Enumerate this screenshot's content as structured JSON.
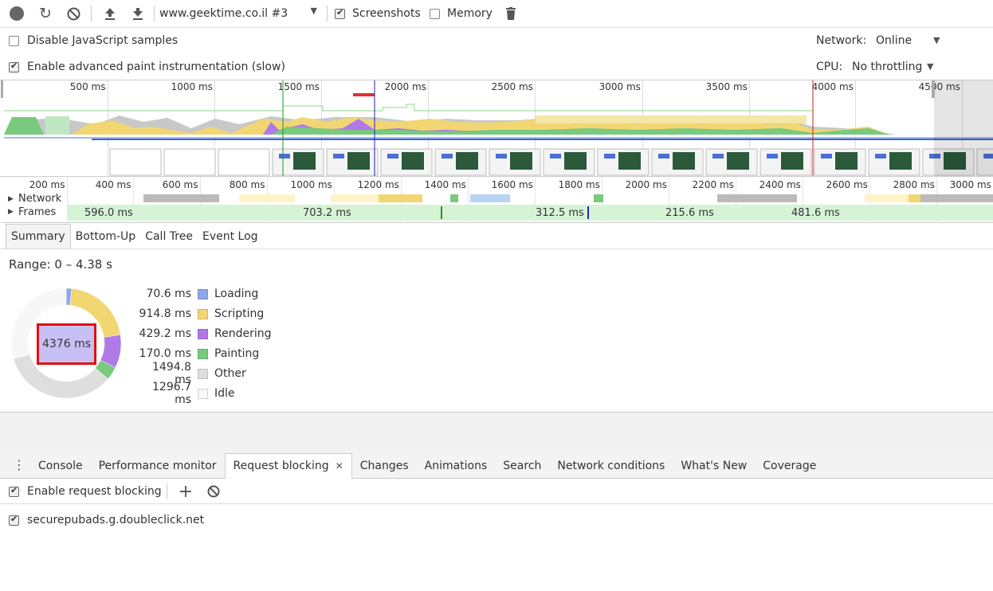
{
  "toolbar": {
    "record_icon": "record-icon",
    "reload_icon": "reload-icon",
    "clear_icon": "clear-icon",
    "upload_icon": "upload-icon",
    "download_icon": "download-icon",
    "profile_select": "www.geektime.co.il #3",
    "screenshots_label": "Screenshots",
    "screenshots_checked": true,
    "memory_label": "Memory",
    "memory_checked": false,
    "trash_icon": "trash-icon"
  },
  "settings": {
    "disable_js_label": "Disable JavaScript samples",
    "disable_js_checked": false,
    "advanced_paint_label": "Enable advanced paint instrumentation (slow)",
    "advanced_paint_checked": true,
    "network_label": "Network:",
    "network_value": "Online",
    "cpu_label": "CPU:",
    "cpu_value": "No throttling"
  },
  "overview": {
    "ticks": [
      "500 ms",
      "1000 ms",
      "1500 ms",
      "2000 ms",
      "2500 ms",
      "3000 ms",
      "3500 ms",
      "4000 ms",
      "4500 ms"
    ]
  },
  "timeline": {
    "ticks": [
      "200 ms",
      "400 ms",
      "600 ms",
      "800 ms",
      "1000 ms",
      "1200 ms",
      "1400 ms",
      "1600 ms",
      "1800 ms",
      "2000 ms",
      "2200 ms",
      "2400 ms",
      "2600 ms",
      "2800 ms",
      "3000 ms"
    ],
    "network_label": "Network",
    "frames_label": "Frames",
    "frame_durations": [
      "596.0 ms",
      "703.2 ms",
      "312.5 ms",
      "215.6 ms",
      "481.6 ms"
    ]
  },
  "tabs": [
    "Summary",
    "Bottom-Up",
    "Call Tree",
    "Event Log"
  ],
  "summary": {
    "range": "Range: 0 – 4.38 s",
    "total": "4376 ms",
    "categories": [
      {
        "value": "70.6 ms",
        "label": "Loading",
        "color": "#8ea7e8",
        "ms": 70.6
      },
      {
        "value": "914.8 ms",
        "label": "Scripting",
        "color": "#f2d672",
        "ms": 914.8
      },
      {
        "value": "429.2 ms",
        "label": "Rendering",
        "color": "#af7ae8",
        "ms": 429.2
      },
      {
        "value": "170.0 ms",
        "label": "Painting",
        "color": "#79c97e",
        "ms": 170.0
      },
      {
        "value": "1494.8 ms",
        "label": "Other",
        "color": "#dedede",
        "ms": 1494.8
      },
      {
        "value": "1296.7 ms",
        "label": "Idle",
        "color": "#f7f7f7",
        "ms": 1296.7
      }
    ]
  },
  "drawer": {
    "tabs": [
      "Console",
      "Performance monitor",
      "Request blocking",
      "Changes",
      "Animations",
      "Search",
      "Network conditions",
      "What's New",
      "Coverage"
    ],
    "active_tab": "Request blocking"
  },
  "request_blocking": {
    "enable_label": "Enable request blocking",
    "enable_checked": true,
    "patterns": [
      {
        "pattern": "securepubads.g.doubleclick.net",
        "checked": true
      }
    ]
  }
}
